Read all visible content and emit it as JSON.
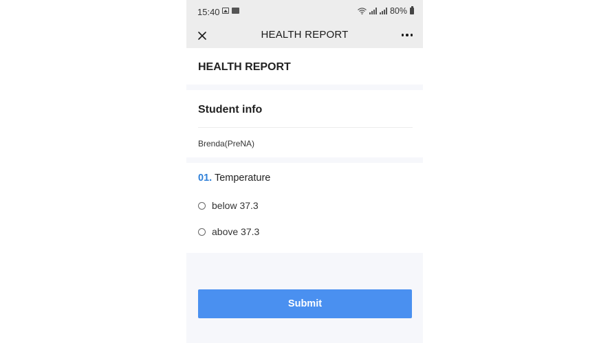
{
  "status_bar": {
    "time": "15:40",
    "battery": "80%"
  },
  "nav": {
    "title": "HEALTH REPORT"
  },
  "header": {
    "heading": "HEALTH REPORT"
  },
  "student_info": {
    "title": "Student info",
    "name": "Brenda(PreNA)"
  },
  "question": {
    "number": "01.",
    "title": "Temperature",
    "options": [
      {
        "label": "below 37.3"
      },
      {
        "label": "above 37.3"
      }
    ]
  },
  "actions": {
    "submit_label": "Submit"
  },
  "colors": {
    "accent": "#4a90f0",
    "question_number": "#2f80d8",
    "nav_background": "#ededed"
  }
}
